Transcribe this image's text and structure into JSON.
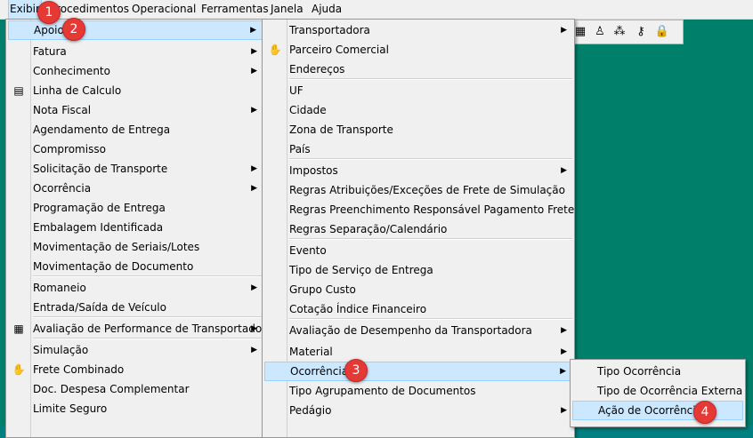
{
  "menubar": {
    "items": [
      "Exibir",
      "Procedimentos",
      "Operacional",
      "Ferramentas",
      "Janela",
      "Ajuda"
    ]
  },
  "toolbar_icons": [
    "calculator-icon",
    "person-icon",
    "people-icon",
    "key-icon",
    "lock-icon"
  ],
  "menu1": {
    "items": [
      {
        "label": "Apoio",
        "submenu": true
      },
      {
        "label": "Fatura",
        "submenu": true
      },
      {
        "label": "Conhecimento",
        "submenu": true
      },
      {
        "label": "Linha de Calculo",
        "icon": "document-icon"
      },
      {
        "label": "Nota Fiscal",
        "submenu": true
      },
      {
        "label": "Agendamento de Entrega"
      },
      {
        "label": "Compromisso"
      },
      {
        "label": "Solicitação de Transporte",
        "submenu": true
      },
      {
        "label": "Ocorrência",
        "submenu": true
      },
      {
        "label": "Programação de Entrega"
      },
      {
        "label": "Embalagem Identificada"
      },
      {
        "label": "Movimentação de Seriais/Lotes"
      },
      {
        "label": "Movimentação de Documento"
      },
      {
        "label": "Romaneio",
        "submenu": true
      },
      {
        "label": "Entrada/Saída de Veículo"
      },
      {
        "label": "Avaliação de Performance de Transportadora",
        "submenu": true,
        "icon": "chart-icon"
      },
      {
        "label": "Simulação",
        "submenu": true
      },
      {
        "label": "Frete Combinado",
        "icon": "handshake-icon"
      },
      {
        "label": "Doc. Despesa Complementar"
      },
      {
        "label": "Limite Seguro"
      }
    ]
  },
  "menu2": {
    "items": [
      {
        "label": "Transportadora",
        "submenu": true
      },
      {
        "label": "Parceiro Comercial",
        "icon": "handshake-icon"
      },
      {
        "label": "Endereços"
      },
      {
        "label": "UF"
      },
      {
        "label": "Cidade"
      },
      {
        "label": "Zona de Transporte"
      },
      {
        "label": "País"
      },
      {
        "label": "Impostos",
        "submenu": true
      },
      {
        "label": "Regras Atribuições/Exceções de Frete de Simulação"
      },
      {
        "label": "Regras Preenchimento Responsável Pagamento Frete ST"
      },
      {
        "label": "Regras Separação/Calendário"
      },
      {
        "label": "Evento"
      },
      {
        "label": "Tipo de Serviço de Entrega"
      },
      {
        "label": "Grupo Custo"
      },
      {
        "label": "Cotação Índice Financeiro"
      },
      {
        "label": "Avaliação de Desempenho da Transportadora",
        "submenu": true
      },
      {
        "label": "Material",
        "submenu": true
      },
      {
        "label": "Ocorrência",
        "submenu": true
      },
      {
        "label": "Tipo Agrupamento de Documentos"
      },
      {
        "label": "Pedágio",
        "submenu": true
      }
    ]
  },
  "menu3": {
    "items": [
      {
        "label": "Tipo Ocorrência"
      },
      {
        "label": "Tipo de Ocorrência Externa"
      },
      {
        "label": "Ação de Ocorrência"
      }
    ]
  },
  "badges": [
    "1",
    "2",
    "3",
    "4"
  ],
  "colors": {
    "desktop": "#00806a",
    "highlight": "#cce8ff",
    "badge": "#e53935"
  }
}
